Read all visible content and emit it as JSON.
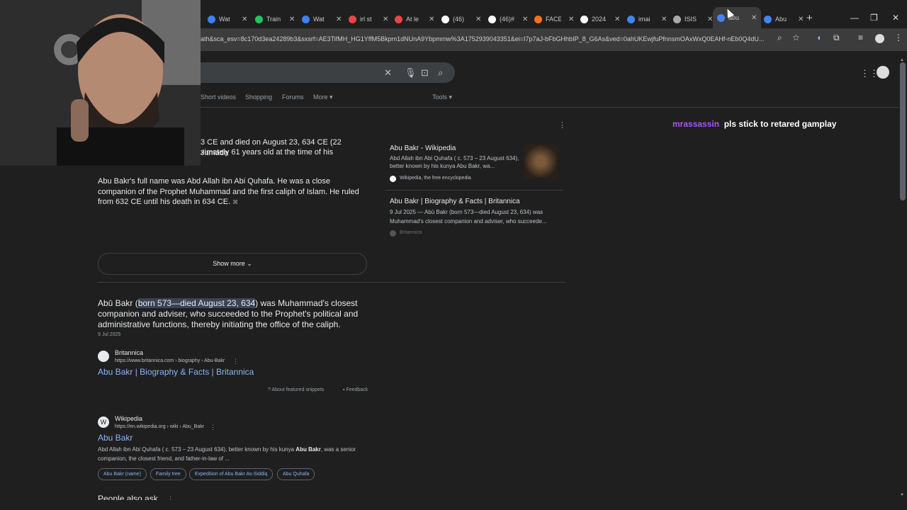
{
  "tabs": [
    {
      "title": "Wat",
      "color": "#3b82f6"
    },
    {
      "title": "Train",
      "color": "#22c55e"
    },
    {
      "title": "Wat",
      "color": "#3b82f6"
    },
    {
      "title": "irl st",
      "color": "#ef4444"
    },
    {
      "title": "At le",
      "color": "#ef4444"
    },
    {
      "title": "(46)",
      "color": "#ffffff"
    },
    {
      "title": "(46)#",
      "color": "#ffffff"
    },
    {
      "title": "FACE",
      "color": "#f97316"
    },
    {
      "title": "2024",
      "color": "#ffffff"
    },
    {
      "title": "imai",
      "color": "#4285f4"
    },
    {
      "title": "ISIS",
      "color": "#aaaaaa"
    },
    {
      "title": "abu",
      "color": "#4285f4",
      "active": true
    },
    {
      "title": "Abu",
      "color": "#4285f4"
    }
  ],
  "window": {
    "minimize": "—",
    "restore": "❐",
    "close": "✕",
    "new_tab": "+"
  },
  "url": "ath&sca_esv=8c170d3ea24289b3&sxsrf=AE3TifMH_HG1YffM5Bkpm1dNUnA9Ybpmmw%3A1752939043351&ei=I7p7aJ-bFbGHhbIP_8_G6As&ved=0ahUKEwjfuPfnnsmOAxWxQ0EAHf-nEb0Q4dU...",
  "nav": {
    "short_videos": "Short videos",
    "shopping": "Shopping",
    "forums": "Forums",
    "more": "More ▾",
    "tools": "Tools ▾"
  },
  "snippet_top": {
    "line1": "3 CE and died on August 23, 634 CE (22 Jumada",
    "line2": "ximately 61 years old at the time of his"
  },
  "snippet_para": "Abu Bakr's full name was Abd Allah ibn Abi Quhafa. He was a close companion of the Prophet Muhammad and the first caliph of Islam. He ruled from 632 CE until his death in 634 CE.",
  "sources": [
    {
      "title": "Abu Bakr - Wikipedia",
      "desc": "Abd Allah ibn Abi Quhafa ( c. 573 – 23 August 634), better known by his kunya Abu Bakr, wa...",
      "site": "Wikipedia, the free encyclopedia"
    },
    {
      "title": "Abu Bakr | Biography & Facts | Britannica",
      "desc": "9 Jul 2025 — Abū Bakr (born 573—died August 23, 634) was Muhammad's closest companion and adviser, who succeede...",
      "site": "Britannica"
    }
  ],
  "show_more": "Show more",
  "featured": {
    "pre": "Abū Bakr (",
    "highlight": "born 573—died August 23, 634",
    "post": ") was Muhammad's closest companion and adviser, who succeeded to the Prophet's political and administrative functions, thereby initiating the office of the caliph.",
    "date": "9 Jul 2025",
    "site": "Britannica",
    "url": "https://www.britannica.com › biography › Abu-Bakr",
    "link": "Abu Bakr | Biography & Facts | Britannica",
    "about": "About featured snippets",
    "feedback": "Feedback"
  },
  "wiki": {
    "site": "Wikipedia",
    "url": "https://en.wikipedia.org › wiki › Abu_Bakr",
    "title": "Abu Bakr",
    "desc_pre": "Abd Allah ibn Abi Quhafa ( c. 573 – 23 August 634), better known by his kunya ",
    "desc_bold": "Abu Bakr",
    "desc_post": ", was a senior companion, the closest friend, and father-in-law of ...",
    "chips": [
      "Abu Bakr (name)",
      "Family tree",
      "Expedition of Abu Bakr As-Siddiq",
      "Abu Quhafa"
    ]
  },
  "paa": "People also ask",
  "chat": {
    "user": "mrassassin",
    "message": "pls stick to retared gamplay",
    "user_color": "#a855f7"
  }
}
